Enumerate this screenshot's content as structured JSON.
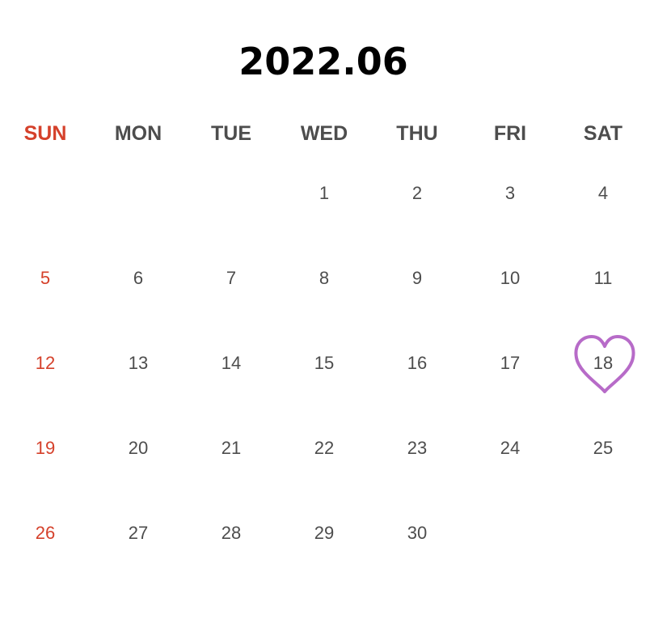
{
  "calendar": {
    "title": "2022.06",
    "colors": {
      "sunday": "#d5412b",
      "text": "#4d4d4d",
      "title": "#000000",
      "heart": "#b76bc8"
    },
    "weekdays": [
      "SUN",
      "MON",
      "TUE",
      "WED",
      "THU",
      "FRI",
      "SAT"
    ],
    "weeks": [
      [
        "",
        "",
        "",
        "1",
        "2",
        "3",
        "4"
      ],
      [
        "5",
        "6",
        "7",
        "8",
        "9",
        "10",
        "11"
      ],
      [
        "12",
        "13",
        "14",
        "15",
        "16",
        "17",
        "18"
      ],
      [
        "19",
        "20",
        "21",
        "22",
        "23",
        "24",
        "25"
      ],
      [
        "26",
        "27",
        "28",
        "29",
        "30",
        "",
        ""
      ]
    ],
    "highlight": {
      "day": "18",
      "icon": "heart-icon"
    }
  }
}
